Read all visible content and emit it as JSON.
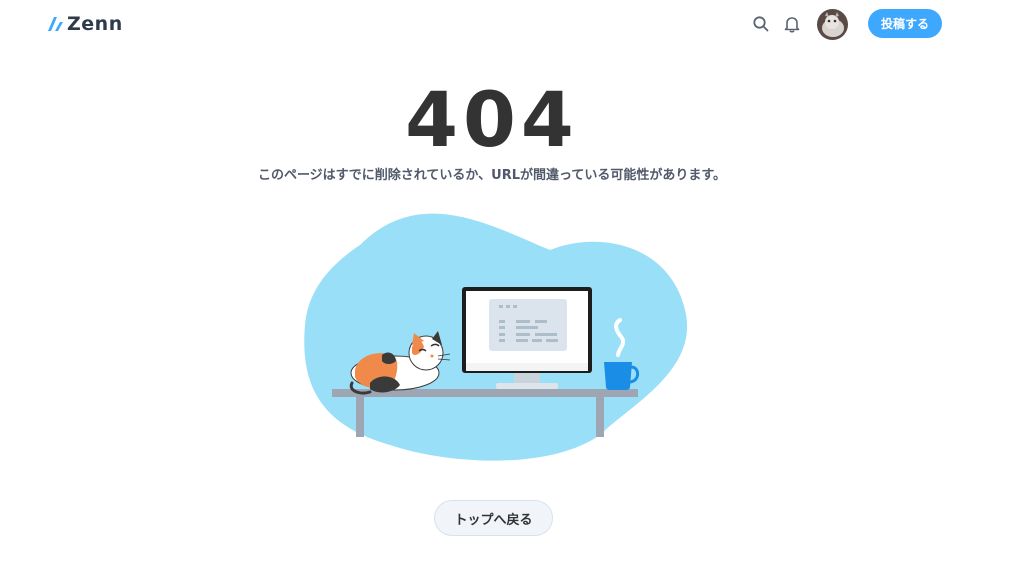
{
  "header": {
    "logo_text": "Zenn",
    "post_button_label": "投稿する",
    "icons": [
      "search-icon",
      "bell-icon",
      "avatar"
    ]
  },
  "error": {
    "code": "404",
    "message": "このページはすでに削除されているか、URLが間違っている可能性があります。"
  },
  "actions": {
    "back_to_top_label": "トップへ戻る"
  },
  "colors": {
    "brand_blue": "#3ea8ff",
    "blob": "#9adff8",
    "text_dark": "#333333",
    "text_muted": "#51596a",
    "desk": "#9ea6b3"
  }
}
